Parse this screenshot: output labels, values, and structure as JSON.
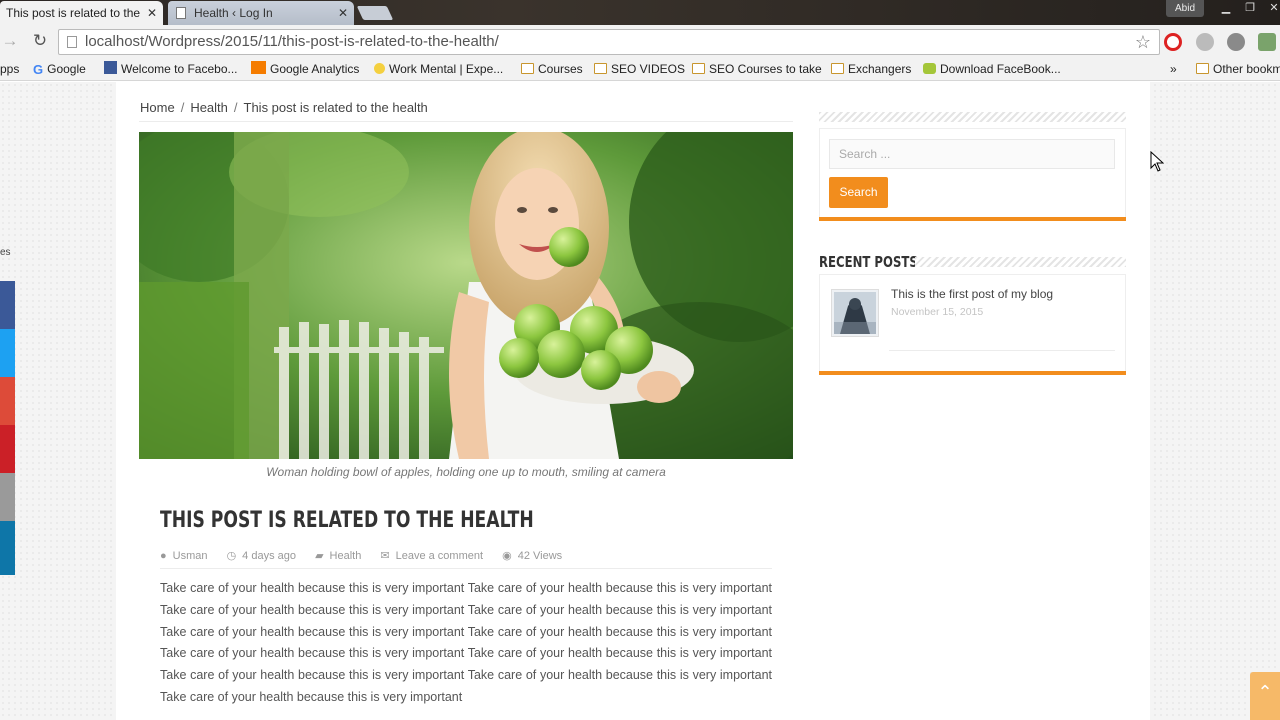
{
  "browser": {
    "tabs": [
      {
        "label": "This post is related to the",
        "active": true
      },
      {
        "label": "Health ‹ Log In",
        "active": false
      }
    ],
    "user_badge": "Abid",
    "url": "localhost/Wordpress/2015/11/this-post-is-related-to-the-health/",
    "bookmarks": [
      {
        "label": "pps",
        "icon": "apps-icon"
      },
      {
        "label": "Google",
        "icon": "google-icon"
      },
      {
        "label": "Welcome to Facebo...",
        "icon": "facebook-icon"
      },
      {
        "label": "Google Analytics",
        "icon": "analytics-icon"
      },
      {
        "label": "Work Mental | Expe...",
        "icon": "bulb-icon"
      },
      {
        "label": "Courses",
        "icon": "folder-icon"
      },
      {
        "label": "SEO VIDEOS",
        "icon": "folder-icon"
      },
      {
        "label": "SEO Courses to take",
        "icon": "folder-icon"
      },
      {
        "label": "Exchangers",
        "icon": "folder-icon"
      },
      {
        "label": "Download FaceBook...",
        "icon": "android-icon"
      }
    ],
    "overflow": "»",
    "other_bookmarks": "Other bookm"
  },
  "breadcrumb": [
    "Home",
    "Health",
    "This post is related to the health"
  ],
  "breadcrumb_sep": "/",
  "post": {
    "image_alt": "Woman holding bowl of apples",
    "caption": "Woman holding bowl of apples, holding one up to mouth, smiling at camera",
    "title": "THIS POST IS RELATED TO THE HEALTH",
    "meta": {
      "author": "Usman",
      "date": "4 days ago",
      "category": "Health",
      "comments": "Leave a comment",
      "views": "42 Views"
    },
    "body": "Take care of your health because this is very important Take care of your health because this is very important Take care of your health because this is very important Take care of your health because this is very important Take care of your health because this is very important Take care of your health because this is very important Take care of your health because this is very important Take care of your health because this is very important Take care of your health because this is very important Take care of your health because this is very important Take care of your health because this is very important"
  },
  "sidebar": {
    "search": {
      "placeholder": "Search ...",
      "button": "Search"
    },
    "recent_posts": {
      "title": "RECENT POSTS",
      "items": [
        {
          "title": "This is the first post of my blog",
          "date": "November 15, 2015"
        }
      ]
    }
  },
  "share_colors": [
    "#3b5998",
    "#1da1f2",
    "#dd4b39",
    "#cb2027",
    "#9a9a9a",
    "#0e76a8"
  ],
  "accent": "#f28d1d",
  "left_edge_text": "es"
}
